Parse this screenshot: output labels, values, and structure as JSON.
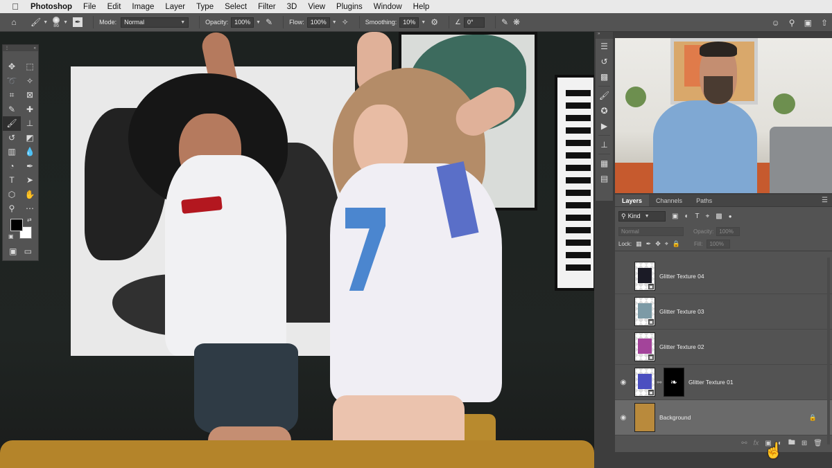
{
  "menubar": {
    "app": "Photoshop",
    "items": [
      "File",
      "Edit",
      "Image",
      "Layer",
      "Type",
      "Select",
      "Filter",
      "3D",
      "View",
      "Plugins",
      "Window",
      "Help"
    ]
  },
  "options": {
    "brush_size": "86",
    "mode_label": "Mode:",
    "mode_value": "Normal",
    "opacity_label": "Opacity:",
    "opacity_value": "100%",
    "flow_label": "Flow:",
    "flow_value": "100%",
    "smoothing_label": "Smoothing:",
    "smoothing_value": "10%",
    "angle_value": "0°"
  },
  "toolbox": {
    "tools": [
      {
        "name": "move-tool-icon",
        "glyph": "✥"
      },
      {
        "name": "marquee-tool-icon",
        "glyph": "⬚"
      },
      {
        "name": "lasso-tool-icon",
        "glyph": "➰"
      },
      {
        "name": "magic-wand-tool-icon",
        "glyph": "✧"
      },
      {
        "name": "crop-tool-icon",
        "glyph": "⌗"
      },
      {
        "name": "frame-tool-icon",
        "glyph": "⊠"
      },
      {
        "name": "eyedropper-tool-icon",
        "glyph": "✎"
      },
      {
        "name": "healing-brush-tool-icon",
        "glyph": "✚"
      },
      {
        "name": "brush-tool-icon",
        "glyph": "🖌"
      },
      {
        "name": "stamp-tool-icon",
        "glyph": "⊥"
      },
      {
        "name": "history-brush-tool-icon",
        "glyph": "↺"
      },
      {
        "name": "eraser-tool-icon",
        "glyph": "◩"
      },
      {
        "name": "gradient-tool-icon",
        "glyph": "▥"
      },
      {
        "name": "blur-tool-icon",
        "glyph": "💧"
      },
      {
        "name": "dodge-tool-icon",
        "glyph": "◔"
      },
      {
        "name": "pen-tool-icon",
        "glyph": "✒"
      },
      {
        "name": "type-tool-icon",
        "glyph": "T"
      },
      {
        "name": "path-selection-tool-icon",
        "glyph": "➤"
      },
      {
        "name": "shape-tool-icon",
        "glyph": "⬡"
      },
      {
        "name": "hand-tool-icon",
        "glyph": "✋"
      },
      {
        "name": "zoom-tool-icon",
        "glyph": "⚲"
      },
      {
        "name": "more-tools-icon",
        "glyph": "⋯"
      }
    ],
    "active_tool_index": 8
  },
  "layers_panel": {
    "tabs": [
      "Layers",
      "Channels",
      "Paths"
    ],
    "active_tab": "Layers",
    "filter_kind": "Kind",
    "blend_mode": "Normal",
    "opacity_label": "Opacity:",
    "opacity_value": "100%",
    "lock_label": "Lock:",
    "fill_label": "Fill:",
    "fill_value": "100%",
    "layers": [
      {
        "name": "Glitter Texture 04",
        "visible": false,
        "selected": false,
        "mask": false,
        "locked": false,
        "color": "#1b1b26"
      },
      {
        "name": "Glitter Texture 03",
        "visible": false,
        "selected": false,
        "mask": false,
        "locked": false,
        "color": "#7c9aa6"
      },
      {
        "name": "Glitter Texture 02",
        "visible": false,
        "selected": false,
        "mask": false,
        "locked": false,
        "color": "#a3449a"
      },
      {
        "name": "Glitter Texture 01",
        "visible": true,
        "selected": false,
        "mask": true,
        "locked": false,
        "color": "#4b4fc0"
      },
      {
        "name": "Background",
        "visible": true,
        "selected": true,
        "mask": false,
        "locked": true,
        "color": "#b98a3c"
      }
    ]
  }
}
